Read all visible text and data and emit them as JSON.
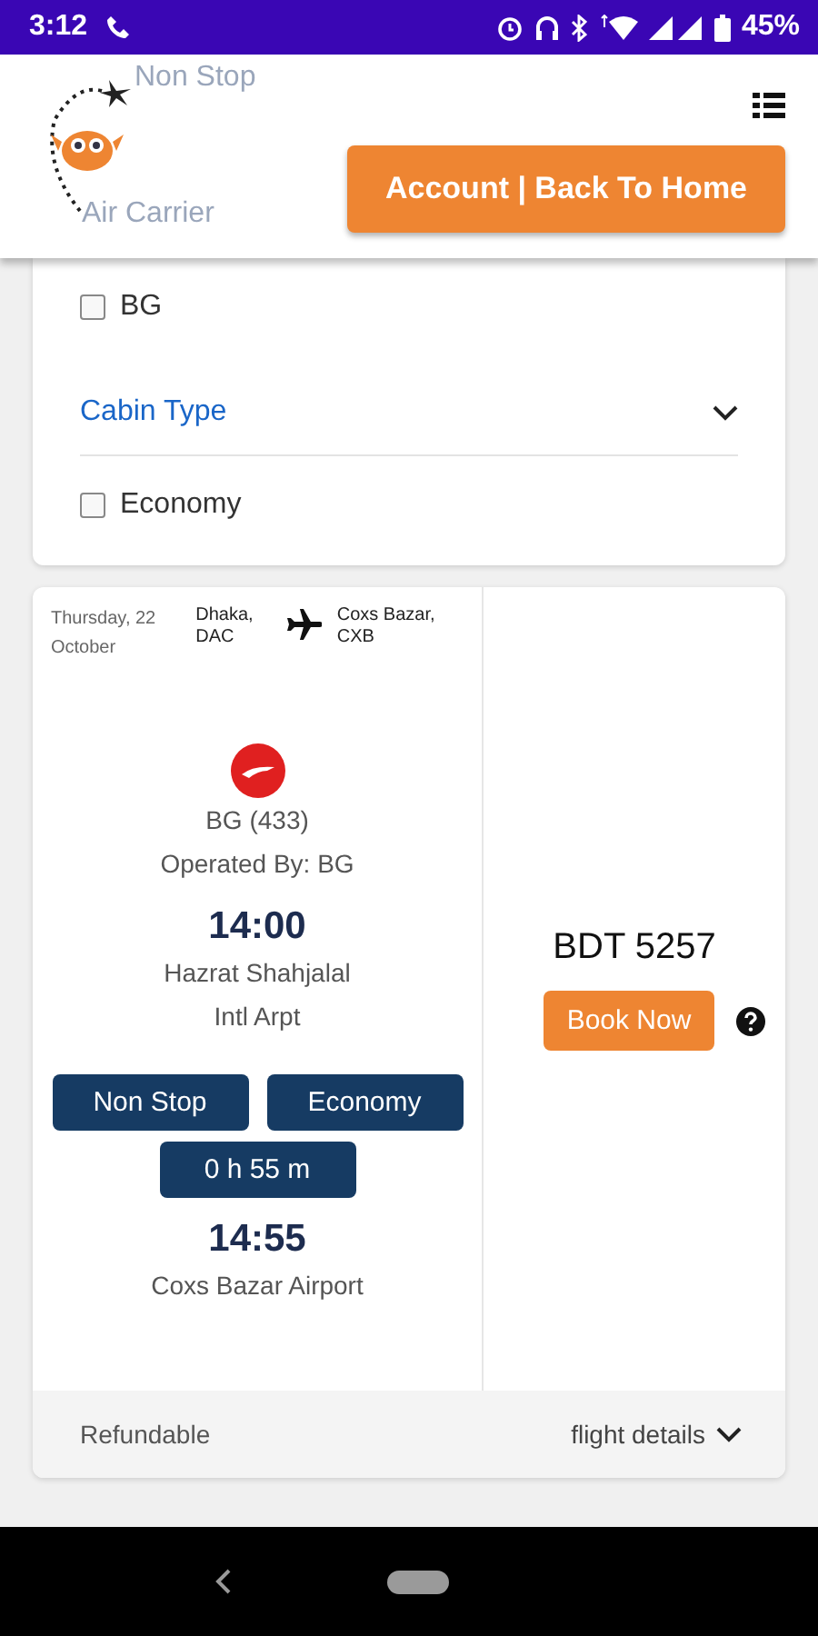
{
  "status_bar": {
    "time": "3:12",
    "battery": "45%"
  },
  "header": {
    "faded_labels": [
      "Non Stop",
      "Air Carrier"
    ],
    "account_button": "Account | Back To Home"
  },
  "filters": [
    {
      "kind": "checkbox",
      "label": "BG",
      "checked": false
    },
    {
      "kind": "section",
      "label": "Cabin Type"
    },
    {
      "kind": "checkbox",
      "label": "Economy",
      "checked": false
    }
  ],
  "flight": {
    "date": "Thursday, 22 October",
    "from": "Dhaka, DAC",
    "to": "Coxs Bazar, CXB",
    "flight_no": "BG (433)",
    "operated_by": "Operated By: BG",
    "depart_time": "14:00",
    "depart_airport": "Hazrat Shahjalal Intl Arpt",
    "tags": [
      "Non Stop",
      "Economy"
    ],
    "duration": "0 h 55 m",
    "arrive_time": "14:55",
    "arrive_airport": "Coxs Bazar Airport",
    "price": "BDT 5257",
    "book_button": "Book Now",
    "refund": "Refundable",
    "details_link": "flight details"
  }
}
